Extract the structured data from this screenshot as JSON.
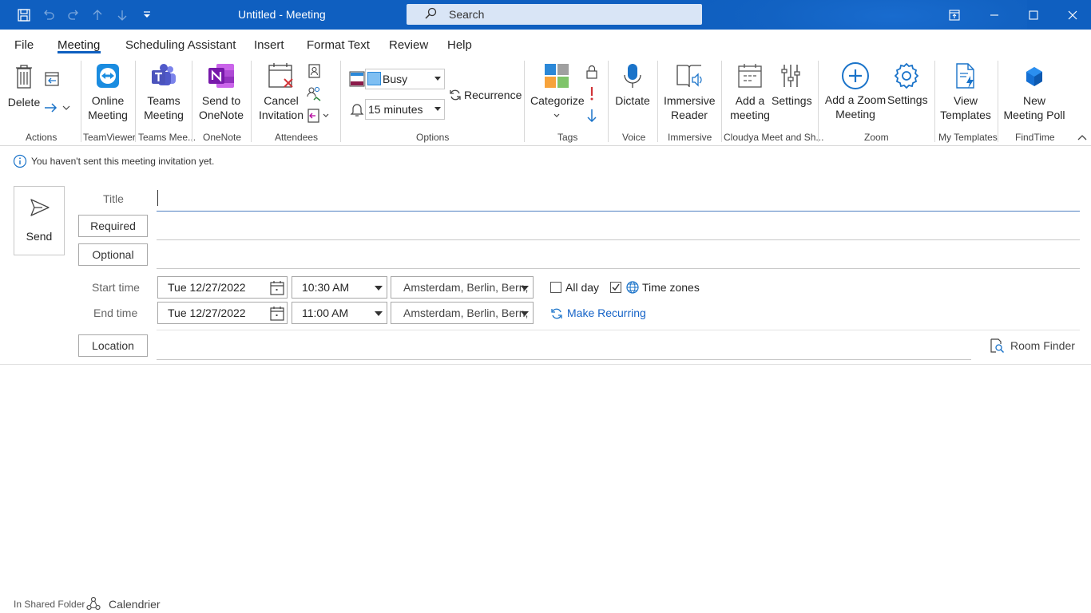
{
  "window": {
    "title": "Untitled  -  Meeting",
    "search_placeholder": "Search"
  },
  "menu": {
    "tabs": [
      "File",
      "Meeting",
      "Scheduling Assistant",
      "Insert",
      "Format Text",
      "Review",
      "Help"
    ],
    "active": "Meeting"
  },
  "ribbon": {
    "actions": {
      "delete": "Delete",
      "group": "Actions"
    },
    "teamviewer": {
      "line1": "Online",
      "line2": "Meeting",
      "group": "TeamViewer"
    },
    "teams": {
      "line1": "Teams",
      "line2": "Meeting",
      "group": "Teams Mee..."
    },
    "onenote": {
      "line1": "Send to",
      "line2": "OneNote",
      "group": "OneNote"
    },
    "attendees": {
      "line1": "Cancel",
      "line2": "Invitation",
      "group": "Attendees"
    },
    "options": {
      "show_as": "Busy",
      "reminder": "15 minutes",
      "recurrence": "Recurrence",
      "group": "Options"
    },
    "tags": {
      "categorize": "Categorize",
      "group": "Tags"
    },
    "voice": {
      "dictate": "Dictate",
      "group": "Voice"
    },
    "immersive": {
      "line1": "Immersive",
      "line2": "Reader",
      "group": "Immersive"
    },
    "cloudya": {
      "add_line1": "Add a",
      "add_line2": "meeting",
      "settings": "Settings",
      "group": "Cloudya Meet and Sh..."
    },
    "zoom": {
      "add_line1": "Add a Zoom",
      "add_line2": "Meeting",
      "settings": "Settings",
      "group": "Zoom"
    },
    "templates": {
      "line1": "View",
      "line2": "Templates",
      "group": "My Templates"
    },
    "findtime": {
      "line1": "New",
      "line2": "Meeting Poll",
      "group": "FindTime"
    }
  },
  "info_message": "You haven't sent this meeting invitation yet.",
  "form": {
    "send": "Send",
    "title_label": "Title",
    "title_value": "",
    "required": "Required",
    "optional": "Optional",
    "start_label": "Start time",
    "start_date": "Tue 12/27/2022",
    "start_time": "10:30 AM",
    "start_tz": "Amsterdam, Berlin, Bern,",
    "end_label": "End time",
    "end_date": "Tue 12/27/2022",
    "end_time": "11:00 AM",
    "end_tz": "Amsterdam, Berlin, Bern,",
    "all_day": "All day",
    "all_day_checked": false,
    "time_zones": "Time zones",
    "time_zones_checked": true,
    "make_recurring": "Make Recurring",
    "location": "Location",
    "room_finder": "Room Finder"
  },
  "footer": {
    "folder": "In Shared Folder",
    "calendar": "Calendrier"
  },
  "colors": {
    "titlebar": "#0f5fc0",
    "accent": "#1563c7"
  }
}
